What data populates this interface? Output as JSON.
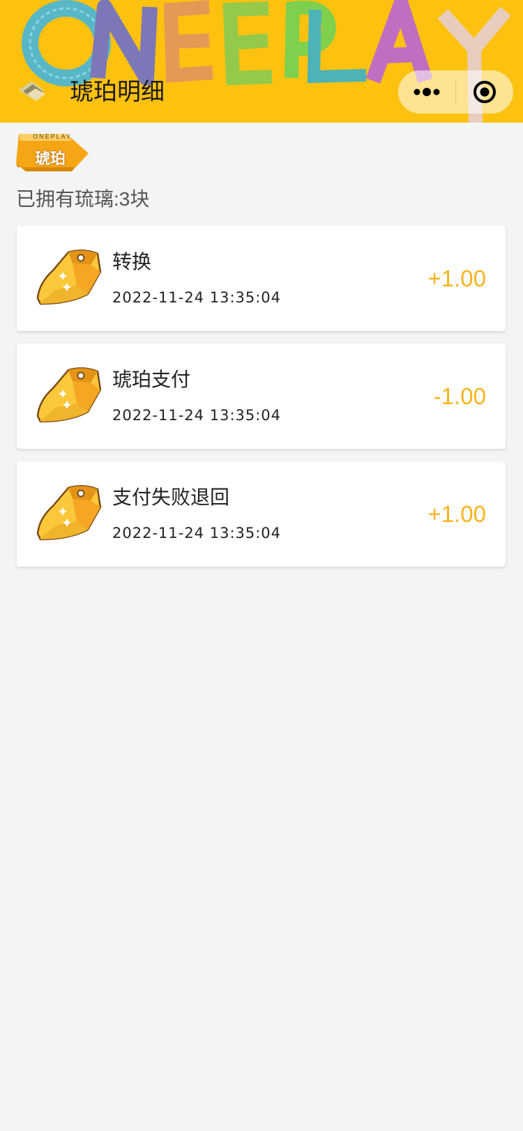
{
  "header": {
    "brand_text": "ONEPLAY",
    "title": "琥珀明细",
    "back_icon": "back-diamond-icon",
    "more_icon": "more-dots-icon",
    "close_icon": "target-close-icon",
    "bg_color": "#fdc10f"
  },
  "tag": {
    "brand": "ONEPLAY",
    "label": "琥珀"
  },
  "summary": {
    "owned_text": "已拥有琉璃:3块"
  },
  "records": [
    {
      "name": "转换",
      "time": "2022-11-24 13:35:04",
      "amount": "+1.00"
    },
    {
      "name": "琥珀支付",
      "time": "2022-11-24 13:35:04",
      "amount": "-1.00"
    },
    {
      "name": "支付失败退回",
      "time": "2022-11-24 13:35:04",
      "amount": "+1.00"
    }
  ],
  "colors": {
    "accent": "#fbb31d",
    "page_bg": "#f3f4f6"
  }
}
